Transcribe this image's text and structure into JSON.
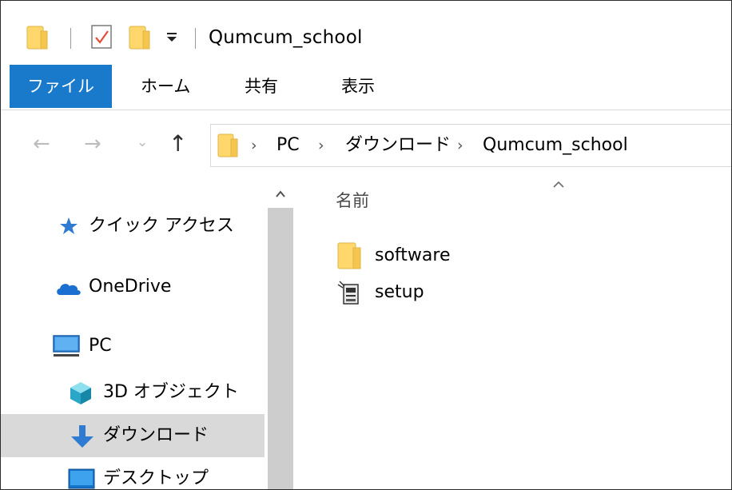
{
  "window": {
    "title": "Qumcum_school"
  },
  "ribbon": {
    "tabs": [
      {
        "label": "ファイル",
        "active": true
      },
      {
        "label": "ホーム"
      },
      {
        "label": "共有"
      },
      {
        "label": "表示"
      }
    ]
  },
  "navigation": {
    "back": "←",
    "forward": "→",
    "recent": "⌄",
    "up": "↑"
  },
  "breadcrumb": [
    {
      "label": "PC"
    },
    {
      "label": "ダウンロード"
    },
    {
      "label": "Qumcum_school"
    }
  ],
  "breadcrumb_separator": "›",
  "sidebar": {
    "items": [
      {
        "label": "クイック アクセス",
        "icon": "star-icon"
      },
      {
        "label": "OneDrive",
        "icon": "cloud-icon"
      },
      {
        "label": "PC",
        "icon": "monitor-icon"
      },
      {
        "label": "3D オブジェクト",
        "icon": "cube-icon"
      },
      {
        "label": "ダウンロード",
        "icon": "download-arrow-icon",
        "selected": true
      },
      {
        "label": "デスクトップ",
        "icon": "desktop-icon"
      }
    ]
  },
  "content": {
    "column_name": "名前",
    "files": [
      {
        "name": "software",
        "type": "folder",
        "icon": "folder-icon"
      },
      {
        "name": "setup",
        "type": "application",
        "icon": "setup-app-icon"
      }
    ]
  },
  "colors": {
    "accent": "#1979ca",
    "folder": "#ffd76b",
    "selected_bg": "#d9d9d9",
    "scroll_thumb": "#cdcdcd"
  }
}
